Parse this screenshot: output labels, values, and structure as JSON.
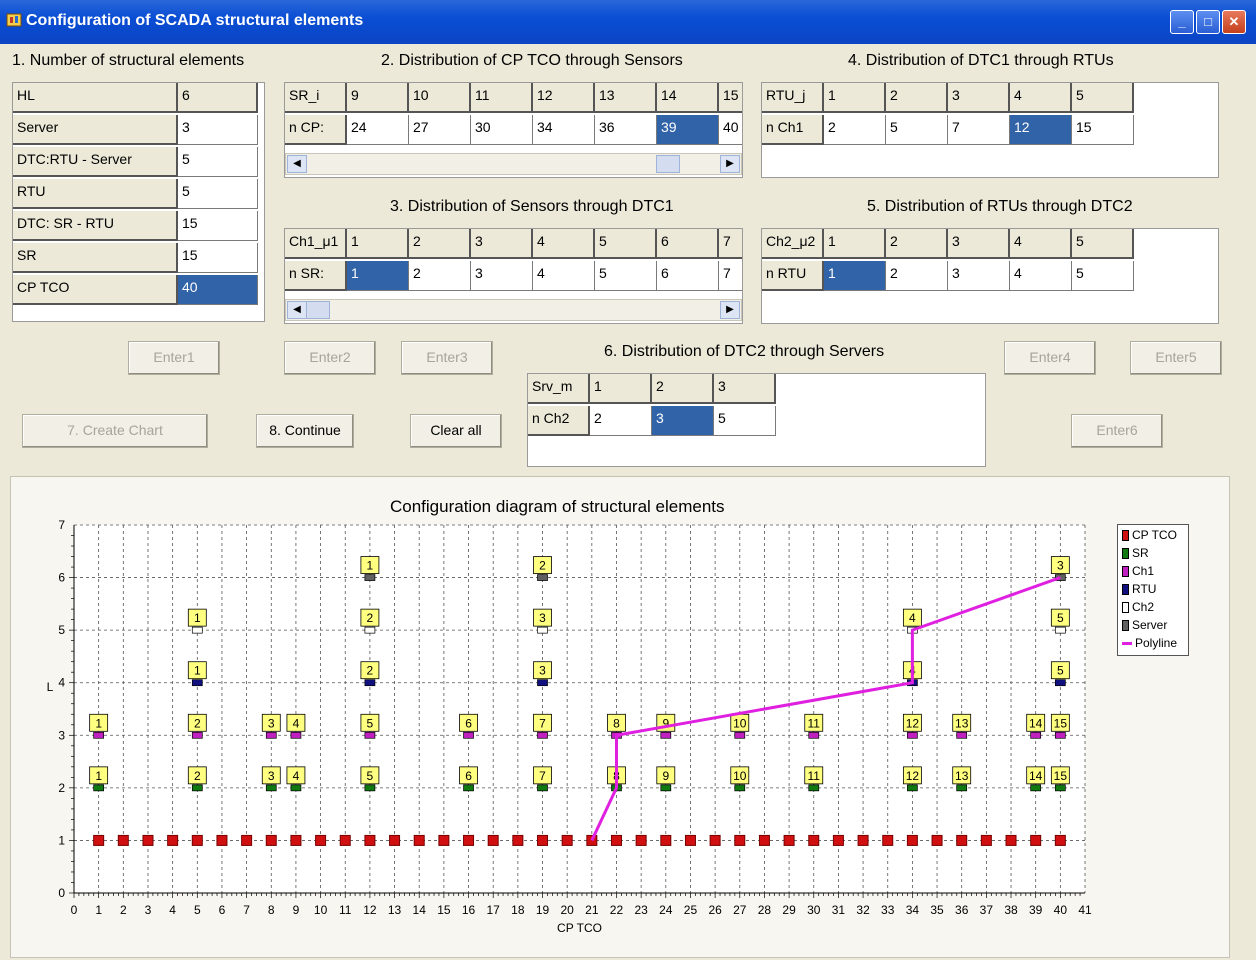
{
  "window": {
    "title": "Configuration of SCADA structural elements"
  },
  "section1": {
    "title": "1. Number of structural elements",
    "rows": [
      {
        "label": "HL",
        "value": "6"
      },
      {
        "label": "Server",
        "value": "3"
      },
      {
        "label": "DTC:RTU - Server",
        "value": "5"
      },
      {
        "label": "RTU",
        "value": "5"
      },
      {
        "label": "DTC: SR - RTU",
        "value": "15"
      },
      {
        "label": "SR",
        "value": "15"
      },
      {
        "label": "CP TCO",
        "value": "40"
      }
    ]
  },
  "section2": {
    "title": "2. Distribution of CP TCO through Sensors",
    "row1_label": "SR_i",
    "row1": [
      "9",
      "10",
      "11",
      "12",
      "13",
      "14",
      "15"
    ],
    "row2_label": "n CP:",
    "row2": [
      "24",
      "27",
      "30",
      "34",
      "36",
      "39",
      "40"
    ]
  },
  "section3": {
    "title": "3. Distribution of Sensors through DTC1",
    "row1_label": "Ch1_μ1",
    "row1": [
      "1",
      "2",
      "3",
      "4",
      "5",
      "6",
      "7"
    ],
    "row2_label": "n SR:",
    "row2": [
      "1",
      "2",
      "3",
      "4",
      "5",
      "6",
      "7"
    ]
  },
  "section4": {
    "title": "4. Distribution of DTC1 through RTUs",
    "row1_label": "RTU_j",
    "row1": [
      "1",
      "2",
      "3",
      "4",
      "5"
    ],
    "row2_label": "n Ch1",
    "row2": [
      "2",
      "5",
      "7",
      "12",
      "15"
    ]
  },
  "section5": {
    "title": "5. Distribution of RTUs through DTC2",
    "row1_label": "Ch2_μ2",
    "row1": [
      "1",
      "2",
      "3",
      "4",
      "5"
    ],
    "row2_label": "n RTU",
    "row2": [
      "1",
      "2",
      "3",
      "4",
      "5"
    ]
  },
  "section6": {
    "title": "6. Distribution of  DTC2 through Servers",
    "row1_label": "Srv_m",
    "row1": [
      "1",
      "2",
      "3"
    ],
    "row2_label": "n Ch2",
    "row2": [
      "2",
      "3",
      "5"
    ]
  },
  "buttons": {
    "enter1": "Enter1",
    "enter2": "Enter2",
    "enter3": "Enter3",
    "enter4": "Enter4",
    "enter5": "Enter5",
    "enter6": "Enter6",
    "create_chart": "7. Create Chart",
    "continue": "8. Continue",
    "clear_all": "Clear all"
  },
  "chart_data": {
    "type": "scatter",
    "title": "Configuration diagram of structural elements",
    "xlabel": "CP TCO",
    "ylabel": "L",
    "xlim": [
      0,
      41
    ],
    "ylim": [
      0,
      7
    ],
    "xticks": [
      "0",
      "1",
      "2",
      "3",
      "4",
      "5",
      "6",
      "7",
      "8",
      "9",
      "10",
      "11",
      "12",
      "13",
      "14",
      "15",
      "16",
      "17",
      "18",
      "19",
      "20",
      "21",
      "22",
      "23",
      "24",
      "25",
      "26",
      "27",
      "28",
      "29",
      "30",
      "31",
      "32",
      "33",
      "34",
      "35",
      "36",
      "37",
      "38",
      "39",
      "40",
      "41"
    ],
    "yticks": [
      "0",
      "1",
      "2",
      "3",
      "4",
      "5",
      "6",
      "7"
    ],
    "grid": true,
    "legend_position": "right",
    "series": [
      {
        "name": "CP TCO",
        "color": "#d01010",
        "y": 1,
        "x": [
          1,
          2,
          3,
          4,
          5,
          6,
          7,
          8,
          9,
          10,
          11,
          12,
          13,
          14,
          15,
          16,
          17,
          18,
          19,
          20,
          21,
          22,
          23,
          24,
          25,
          26,
          27,
          28,
          29,
          30,
          31,
          32,
          33,
          34,
          35,
          36,
          37,
          38,
          39,
          40
        ]
      },
      {
        "name": "SR",
        "color": "#107a10",
        "y": 2,
        "x": [
          1,
          5,
          8,
          9,
          12,
          16,
          19,
          22,
          24,
          27,
          30,
          34,
          36,
          39,
          40
        ],
        "labels": [
          "1",
          "2",
          "3",
          "4",
          "5",
          "6",
          "7",
          "8",
          "9",
          "10",
          "11",
          "12",
          "13",
          "14",
          "15"
        ]
      },
      {
        "name": "Ch1",
        "color": "#c020c0",
        "y": 3,
        "x": [
          1,
          5,
          8,
          9,
          12,
          16,
          19,
          22,
          24,
          27,
          30,
          34,
          36,
          39,
          40
        ],
        "labels": [
          "1",
          "2",
          "3",
          "4",
          "5",
          "6",
          "7",
          "8",
          "9",
          "10",
          "11",
          "12",
          "13",
          "14",
          "15"
        ]
      },
      {
        "name": "RTU",
        "color": "#101080",
        "y": 4,
        "x": [
          5,
          12,
          19,
          34,
          40
        ],
        "labels": [
          "1",
          "2",
          "3",
          "4",
          "5"
        ]
      },
      {
        "name": "Ch2",
        "color": "#ffffff",
        "y": 5,
        "x": [
          5,
          12,
          19,
          34,
          40
        ],
        "labels": [
          "1",
          "2",
          "3",
          "4",
          "5"
        ]
      },
      {
        "name": "Server",
        "color": "#606060",
        "y": 6,
        "x": [
          12,
          19,
          40
        ],
        "labels": [
          "1",
          "2",
          "3"
        ]
      }
    ],
    "polyline": {
      "name": "Polyline",
      "color": "#e020e0",
      "points": [
        [
          21,
          1
        ],
        [
          22,
          2
        ],
        [
          22,
          3
        ],
        [
          34,
          4
        ],
        [
          34,
          5
        ],
        [
          40,
          6
        ]
      ]
    }
  }
}
